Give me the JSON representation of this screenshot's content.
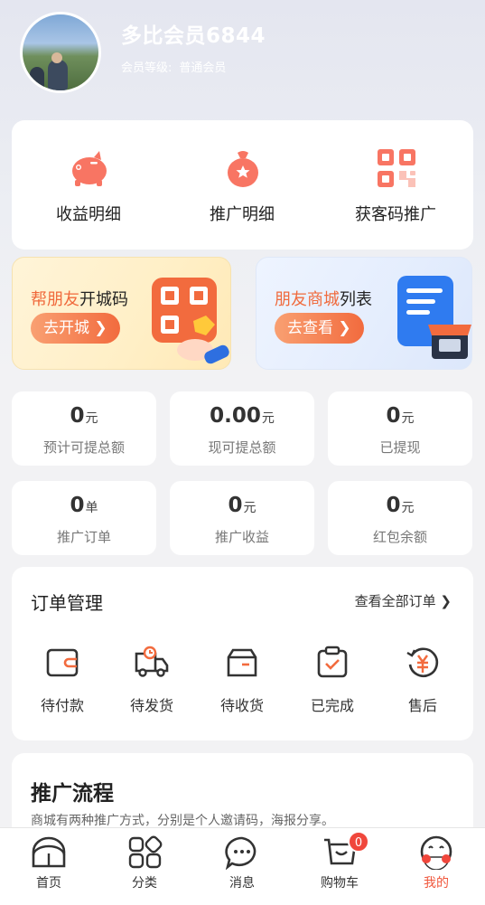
{
  "profile": {
    "username": "多比会员6844",
    "level_label": "会员等级:",
    "level_value": "普通会员"
  },
  "quick_actions": [
    {
      "label": "收益明细",
      "icon": "piggy-bank-icon"
    },
    {
      "label": "推广明细",
      "icon": "money-bag-icon"
    },
    {
      "label": "获客码推广",
      "icon": "qr-code-icon"
    }
  ],
  "promos": [
    {
      "title_hl": "帮朋友",
      "title_rest": "开城码",
      "button": "去开城 ❯"
    },
    {
      "title_hl": "朋友商城",
      "title_rest": "列表",
      "button": "去查看 ❯"
    }
  ],
  "stats": [
    {
      "value": "0",
      "unit": "元",
      "label": "预计可提总额"
    },
    {
      "value": "0.00",
      "unit": "元",
      "label": "现可提总额"
    },
    {
      "value": "0",
      "unit": "元",
      "label": "已提现"
    },
    {
      "value": "0",
      "unit": "单",
      "label": "推广订单"
    },
    {
      "value": "0",
      "unit": "元",
      "label": "推广收益"
    },
    {
      "value": "0",
      "unit": "元",
      "label": "红包余额"
    }
  ],
  "orders": {
    "title": "订单管理",
    "view_all": "查看全部订单 ❯",
    "items": [
      {
        "label": "待付款",
        "icon": "wallet-icon"
      },
      {
        "label": "待发货",
        "icon": "delivery-truck-icon"
      },
      {
        "label": "待收货",
        "icon": "package-box-icon"
      },
      {
        "label": "已完成",
        "icon": "clipboard-check-icon"
      },
      {
        "label": "售后",
        "icon": "refund-yuan-icon"
      }
    ]
  },
  "process": {
    "title": "推广流程",
    "desc": "商城有两种推广方式，分别是个人邀请码，海报分享。"
  },
  "tabbar": {
    "items": [
      {
        "label": "首页",
        "icon": "home-icon"
      },
      {
        "label": "分类",
        "icon": "category-icon"
      },
      {
        "label": "消息",
        "icon": "message-icon"
      },
      {
        "label": "购物车",
        "icon": "cart-icon",
        "badge": "0"
      },
      {
        "label": "我的",
        "icon": "profile-icon"
      }
    ]
  },
  "colors": {
    "accent": "#f26b3e",
    "tab_active": "#f0573c",
    "badge": "#f0473c"
  }
}
